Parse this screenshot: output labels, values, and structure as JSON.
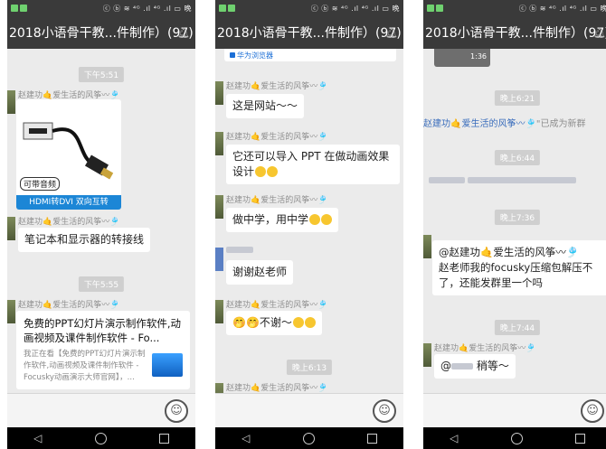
{
  "status": {
    "icons_right": "ⓒ ⓑ ≋ ⁴ᴳ .ıl ⁴ᴳ .ıl ▭ 晚"
  },
  "title": "2018小语骨干教...件制作）(97)",
  "bell_icon": "bell-icon",
  "phone1": {
    "ts1": "下午5:51",
    "sender": "赵建功🤙爱生活的风筝〰🎐",
    "image_badge": "可带音频",
    "image_caption": "HDMI转DVI 双向互转",
    "msg1": "笔记本和显示器的转接线",
    "ts2": "下午5:55",
    "link_title": "免费的PPT幻灯片演示制作软件,动画视频及课件制作软件 - Fo...",
    "link_desc": "我正在看【免费的PPT幻灯片演示制作软件,动画视频及课件制作软件 - Focusky动画演示大师官网】，..."
  },
  "phone2": {
    "browser_label": "华为浏览器",
    "sender": "赵建功🤙爱生活的风筝〰🎐",
    "msg1": "这是网站～～",
    "msg2": "它还可以导入 PPT 在做动画效果设计",
    "msg3": "做中学，用中学",
    "msg4": "谢谢赵老师",
    "msg5": "🤭🤭不谢～",
    "ts1": "晚上6:13"
  },
  "phone3": {
    "video_duration": "1:36",
    "ts1": "晚上6:21",
    "sys_sender": "赵建功🤙爱生活的风筝〰🎐",
    "sys_text": "\"已成为新群",
    "ts2": "晚上6:44",
    "ts3": "晚上7:36",
    "msg1_mention": "@赵建功🤙爱生活的风筝〰🎐",
    "msg1_text": "赵老师我的focusky压缩包解压不了，还能发群里一个吗",
    "ts4": "晚上7:44",
    "sender": "赵建功🤙爱生活的风筝〰🎐",
    "msg2_prefix": "@",
    "msg2_text": "稍等～"
  },
  "nav": {
    "back": "◁"
  }
}
